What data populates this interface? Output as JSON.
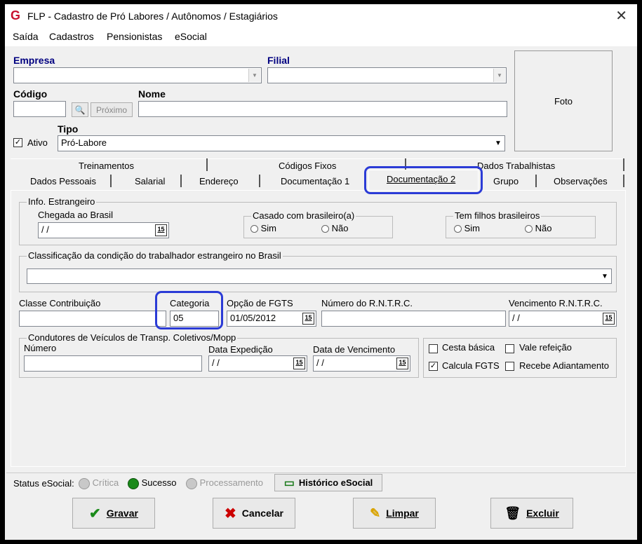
{
  "window": {
    "title": "FLP - Cadastro de Pró Labores / Autônomos / Estagiários"
  },
  "menu": [
    "Saída",
    "Cadastros",
    "Pensionistas",
    "eSocial"
  ],
  "header": {
    "empresa_label": "Empresa",
    "filial_label": "Filial",
    "codigo_label": "Código",
    "proximo_label": "Próximo",
    "nome_label": "Nome",
    "ativo_label": "Ativo",
    "tipo_label": "Tipo",
    "tipo_value": "Pró-Labore",
    "foto_label": "Foto"
  },
  "tabs_row1": [
    "Treinamentos",
    "Códigos Fixos",
    "Dados Trabalhistas"
  ],
  "tabs_row2": [
    "Dados Pessoais",
    "Salarial",
    "Endereço",
    "Documentação 1",
    "Documentação 2",
    "Grupo",
    "Observações"
  ],
  "estrangeiro": {
    "group_title": "Info. Estrangeiro",
    "chegada_label": "Chegada ao Brasil",
    "chegada_value": " / /",
    "casado_title": "Casado com brasileiro(a)",
    "filhos_title": "Tem filhos brasileiros",
    "sim": "Sim",
    "nao": "Não"
  },
  "classificacao": {
    "title": "Classificação da condição do trabalhador estrangeiro no Brasil"
  },
  "row3": {
    "classe_label": "Classe Contribuição",
    "categoria_label": "Categoria",
    "categoria_value": "05",
    "fgts_label": "Opção de FGTS",
    "fgts_value": "01/05/2012",
    "rntrc_label": "Número do R.N.T.R.C.",
    "venc_rntrc_label": "Vencimento R.N.T.R.C.",
    "venc_rntrc_value": " / /"
  },
  "condutores": {
    "title": "Condutores de Veículos de Transp. Coletivos/Mopp",
    "numero_label": "Número",
    "data_exp_label": "Data Expedição",
    "data_exp_value": " / /",
    "data_venc_label": "Data de Vencimento",
    "data_venc_value": " / /"
  },
  "beneficios": {
    "cesta": "Cesta básica",
    "vale": "Vale refeição",
    "calcula_fgts": "Calcula FGTS",
    "adiantamento": "Recebe Adiantamento"
  },
  "status": {
    "label": "Status eSocial:",
    "critica": "Crítica",
    "sucesso": "Sucesso",
    "processamento": "Processamento",
    "historico": "Histórico eSocial"
  },
  "buttons": {
    "gravar": "Gravar",
    "cancelar": "Cancelar",
    "limpar": "Limpar",
    "excluir": "Excluir"
  }
}
